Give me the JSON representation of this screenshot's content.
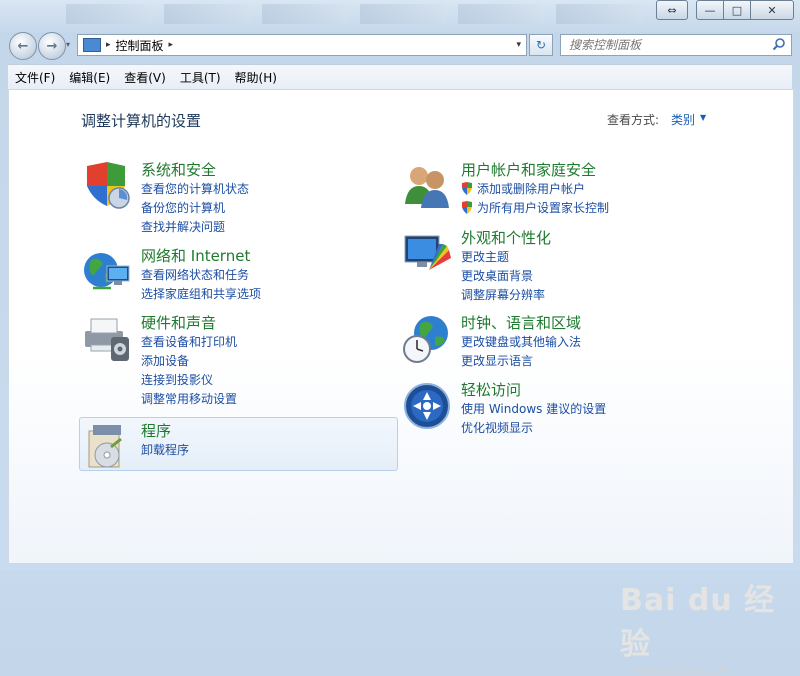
{
  "window": {
    "caption_buttons": {
      "restore_drag": "⇔",
      "minimize": "—",
      "maximize": "□",
      "close": "✕"
    }
  },
  "nav": {
    "back_icon": "←",
    "forward_icon": "→",
    "history_icon": "▾",
    "breadcrumb": "控制面板",
    "crumb_separator": "▸",
    "address_dropdown": "▾",
    "refresh_icon": "↻",
    "search_placeholder": "搜索控制面板"
  },
  "menu": [
    "文件(F)",
    "编辑(E)",
    "查看(V)",
    "工具(T)",
    "帮助(H)"
  ],
  "page": {
    "title": "调整计算机的设置",
    "view_by_label": "查看方式:",
    "view_by_value": "类别",
    "view_by_arrow": "▼"
  },
  "categories": [
    {
      "title": "系统和安全",
      "icon": "system-security-icon",
      "links": [
        "查看您的计算机状态",
        "备份您的计算机",
        "查找并解决问题"
      ]
    },
    {
      "title": "网络和 Internet",
      "icon": "network-internet-icon",
      "links": [
        "查看网络状态和任务",
        "选择家庭组和共享选项"
      ]
    },
    {
      "title": "硬件和声音",
      "icon": "hardware-sound-icon",
      "links": [
        "查看设备和打印机",
        "添加设备",
        "连接到投影仪",
        "调整常用移动设置"
      ]
    },
    {
      "title": "程序",
      "icon": "programs-icon",
      "links": [
        "卸载程序"
      ]
    },
    {
      "title": "用户帐户和家庭安全",
      "icon": "user-accounts-icon",
      "links": [
        "添加或删除用户帐户",
        "为所有用户设置家长控制"
      ]
    },
    {
      "title": "外观和个性化",
      "icon": "appearance-icon",
      "links": [
        "更改主题",
        "更改桌面背景",
        "调整屏幕分辨率"
      ]
    },
    {
      "title": "时钟、语言和区域",
      "icon": "clock-language-icon",
      "links": [
        "更改键盘或其他输入法",
        "更改显示语言"
      ]
    },
    {
      "title": "轻松访问",
      "icon": "ease-of-access-icon",
      "links": [
        "使用 Windows 建议的设置",
        "优化视频显示"
      ]
    }
  ],
  "watermark": {
    "logo": "Bai du 经验",
    "url": "jingyan.baidu.com"
  }
}
